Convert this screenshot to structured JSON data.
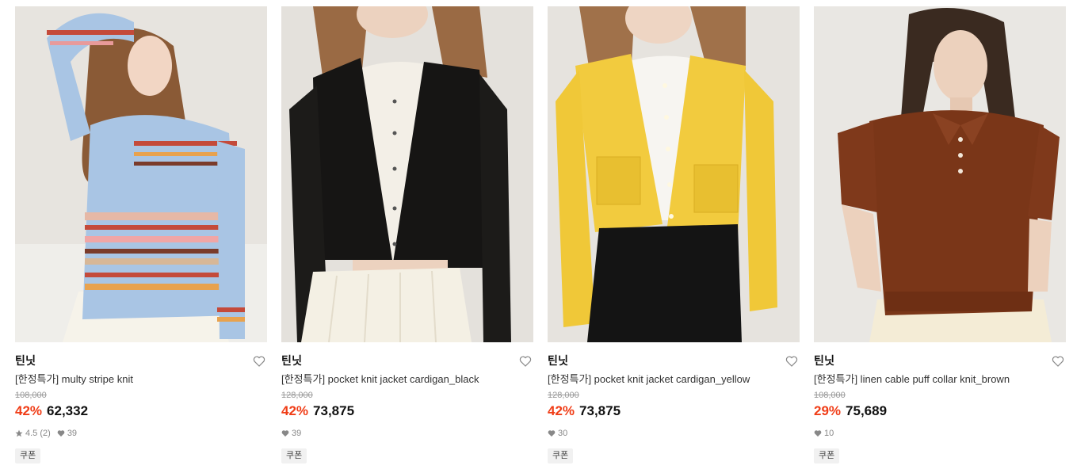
{
  "products": [
    {
      "brand": "틴닛",
      "title": "[한정특가] multy stripe knit",
      "original_price": "108,000",
      "discount": "42%",
      "price": "62,332",
      "rating": "4.5",
      "review_count": "(2)",
      "likes": "39",
      "badge": "쿠폰",
      "image_desc": "model-striped-pastel-knit"
    },
    {
      "brand": "틴닛",
      "title": "[한정특가] pocket knit jacket cardigan_black",
      "original_price": "128,000",
      "discount": "42%",
      "price": "73,875",
      "likes": "39",
      "badge": "쿠폰",
      "image_desc": "model-black-cardigan"
    },
    {
      "brand": "틴닛",
      "title": "[한정특가] pocket knit jacket cardigan_yellow",
      "original_price": "128,000",
      "discount": "42%",
      "price": "73,875",
      "likes": "30",
      "badge": "쿠폰",
      "image_desc": "model-yellow-cardigan"
    },
    {
      "brand": "틴닛",
      "title": "[한정특가] linen cable puff collar knit_brown",
      "original_price": "108,000",
      "discount": "29%",
      "price": "75,689",
      "likes": "10",
      "badge": "쿠폰",
      "image_desc": "model-brown-polo-knit"
    }
  ],
  "colors": {
    "discount": "#f03d17",
    "price": "#111111",
    "muted": "#9a9a9a"
  },
  "icons": {
    "wishlist": "heart-outline-icon",
    "rating": "star-icon",
    "likes": "heart-filled-icon"
  }
}
